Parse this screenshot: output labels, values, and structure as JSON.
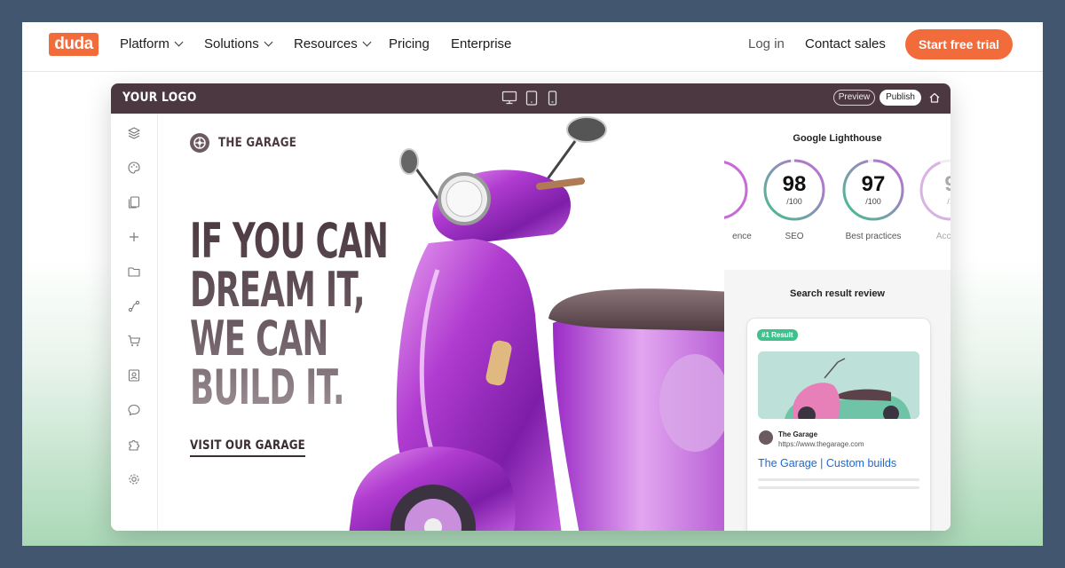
{
  "nav": {
    "logo": "duda",
    "items": [
      {
        "label": "Platform",
        "dropdown": true
      },
      {
        "label": "Solutions",
        "dropdown": true
      },
      {
        "label": "Resources",
        "dropdown": true
      },
      {
        "label": "Pricing",
        "dropdown": false
      },
      {
        "label": "Enterprise",
        "dropdown": false
      }
    ],
    "login": "Log in",
    "contact": "Contact sales",
    "cta": "Start free trial"
  },
  "editor": {
    "logo": "YOUR LOGO",
    "preview": "Preview",
    "publish": "Publish",
    "devices": [
      "desktop-icon",
      "tablet-icon",
      "mobile-icon"
    ],
    "sidebar_icons": [
      "layers-icon",
      "palette-icon",
      "pages-icon",
      "plus-icon",
      "folder-icon",
      "connect-icon",
      "cart-icon",
      "contact-card-icon",
      "chat-icon",
      "puzzle-icon",
      "settings-icon"
    ]
  },
  "site": {
    "brand": "THE GARAGE",
    "headline": [
      "IF YOU CAN",
      "DREAM IT,",
      "WE CAN",
      "BUILD IT."
    ],
    "cta": "VISIT OUR GARAGE"
  },
  "lighthouse": {
    "title": "Google Lighthouse",
    "scores": [
      {
        "score": "",
        "max": "",
        "label": "ence"
      },
      {
        "score": "98",
        "max": "/100",
        "label": "SEO"
      },
      {
        "score": "97",
        "max": "/100",
        "label": "Best practices"
      },
      {
        "score": "9",
        "max": "/1",
        "label": "Access"
      }
    ]
  },
  "search_result": {
    "title": "Search result review",
    "badge": "#1 Result",
    "site_name": "The Garage",
    "url": "https://www.thegarage.com",
    "link": "The Garage | Custom builds"
  },
  "colors": {
    "brand_orange": "#f26b3a",
    "editor_bar": "#4b3840",
    "badge_green": "#3fc18d",
    "link_blue": "#1a6ad1"
  }
}
